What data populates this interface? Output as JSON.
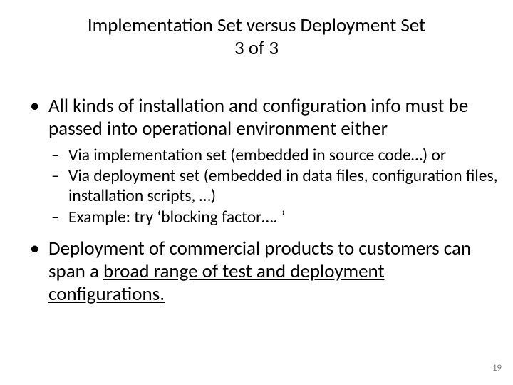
{
  "title_line1": "Implementation Set versus Deployment Set",
  "title_line2": "3 of 3",
  "bullets": [
    {
      "text": "All kinds of installation and configuration info must be passed into operational environment either",
      "sub": [
        "Via implementation set (embedded in source code…) or",
        "Via deployment set (embedded in data files, configuration files, installation scripts, …)",
        "Example:  try ‘blocking factor…. ’"
      ]
    },
    {
      "text_prefix": "Deployment of commercial products to customers can span a ",
      "text_underlined": "broad range of test and deployment configurations.",
      "sub": []
    }
  ],
  "page_number": "19"
}
